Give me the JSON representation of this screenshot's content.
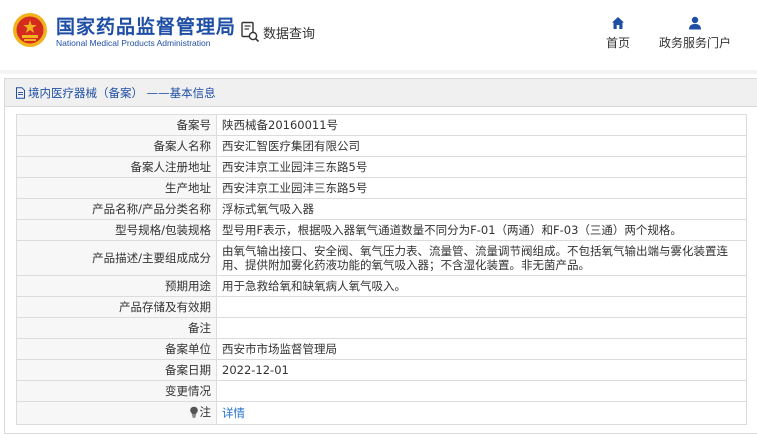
{
  "header": {
    "brand_cn": "国家药品监督管理局",
    "brand_en": "National Medical Products Administration",
    "search_label": "数据查询",
    "nav": [
      {
        "label": "首页",
        "icon": "home-icon"
      },
      {
        "label": "政务服务门户",
        "icon": "user-icon"
      }
    ]
  },
  "panel": {
    "title": "境内医疗器械（备案） ——基本信息",
    "rows": [
      {
        "key": "备案号",
        "value": "陕西械备20160011号"
      },
      {
        "key": "备案人名称",
        "value": "西安汇智医疗集团有限公司"
      },
      {
        "key": "备案人注册地址",
        "value": "西安沣京工业园沣三东路5号"
      },
      {
        "key": "生产地址",
        "value": "西安沣京工业园沣三东路5号"
      },
      {
        "key": "产品名称/产品分类名称",
        "value": "浮标式氧气吸入器"
      },
      {
        "key": "型号规格/包装规格",
        "value": "型号用F表示，根据吸入器氧气通道数量不同分为F-01（两通）和F-03（三通）两个规格。"
      },
      {
        "key": "产品描述/主要组成成分",
        "value": "由氧气输出接口、安全阀、氧气压力表、流量管、流量调节阀组成。不包括氧气输出端与雾化装置连用、提供附加雾化药液功能的氧气吸入器；不含湿化装置。非无菌产品。"
      },
      {
        "key": "预期用途",
        "value": "用于急救给氧和缺氧病人氧气吸入。"
      },
      {
        "key": "产品存储及有效期",
        "value": ""
      },
      {
        "key": "备注",
        "value": ""
      },
      {
        "key": "备案单位",
        "value": "西安市市场监督管理局"
      },
      {
        "key": "备案日期",
        "value": "2022-12-01"
      },
      {
        "key": "变更情况",
        "value": ""
      }
    ],
    "note": {
      "key": "注",
      "link": "详情"
    }
  },
  "colors": {
    "brand_blue": "#1f4fa5",
    "link_blue": "#1f6fcf",
    "logo_red": "#d42a1f",
    "logo_gold": "#f2b21b"
  }
}
